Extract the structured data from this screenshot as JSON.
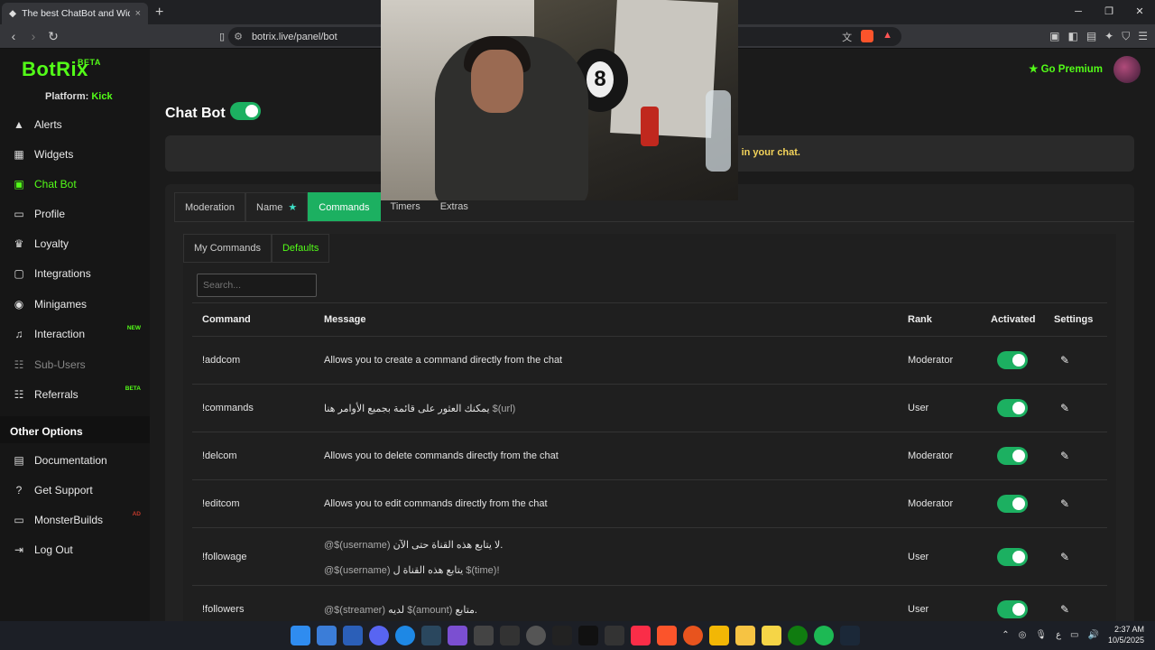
{
  "browser": {
    "tab_title": "The best ChatBot and Widgets fo",
    "url": "botrix.live/panel/bot",
    "new_tab": "+",
    "close_tab": "×"
  },
  "sidebar": {
    "brand": "BotRix",
    "brand_badge": "BETA",
    "platform_label": "Platform:",
    "platform_value": "Kick",
    "items": [
      {
        "label": "Alerts",
        "icon": "warning-icon"
      },
      {
        "label": "Widgets",
        "icon": "grid-icon"
      },
      {
        "label": "Chat Bot",
        "icon": "robot-icon"
      },
      {
        "label": "Profile",
        "icon": "id-card-icon"
      },
      {
        "label": "Loyalty",
        "icon": "trophy-icon"
      },
      {
        "label": "Integrations",
        "icon": "box-icon"
      },
      {
        "label": "Minigames",
        "icon": "gamepad-icon"
      },
      {
        "label": "Interaction",
        "icon": "music-icon",
        "tag": "NEW"
      },
      {
        "label": "Sub-Users",
        "icon": "users-icon"
      },
      {
        "label": "Referrals",
        "icon": "users-icon",
        "tag": "BETA"
      }
    ],
    "other_title": "Other Options",
    "other_items": [
      {
        "label": "Documentation",
        "icon": "book-icon"
      },
      {
        "label": "Get Support",
        "icon": "question-icon"
      },
      {
        "label": "MonsterBuilds",
        "icon": "monitor-icon",
        "tag": "AD"
      },
      {
        "label": "Log Out",
        "icon": "logout-icon"
      }
    ],
    "colors": {
      "accent": "#53fc18",
      "active_toggle": "#1cb061"
    }
  },
  "header": {
    "title": "Chat Bot",
    "premium": "Go Premium"
  },
  "banner": {
    "text": "in your chat."
  },
  "tabs": [
    "Moderation",
    "Name",
    "Commands",
    "Timers",
    "Extras"
  ],
  "subtabs": [
    "My Commands",
    "Defaults"
  ],
  "search": {
    "placeholder": "Search..."
  },
  "table": {
    "headers": [
      "Command",
      "Message",
      "Rank",
      "Activated",
      "Settings"
    ],
    "rows": [
      {
        "command": "!addcom",
        "message": "Allows you to create a command directly from the chat",
        "rank": "Moderator"
      },
      {
        "command": "!commands",
        "message": "يمكنك العثور على قائمة بجميع الأوامر هنا",
        "message_var": "$(url)",
        "rank": "User"
      },
      {
        "command": "!delcom",
        "message": "Allows you to delete commands directly from the chat",
        "rank": "Moderator"
      },
      {
        "command": "!editcom",
        "message": "Allows you to edit commands directly from the chat",
        "rank": "Moderator"
      },
      {
        "command": "!followage",
        "message_line1_var": "@$(username)",
        "message_line1": "لا يتابع هذه القناة حتى الآن.",
        "message_line2_var": "@$(username)",
        "message_line2": "يتابع هذه القناة ل",
        "message_line2_var2": "$(time)!",
        "rank": "User"
      },
      {
        "command": "!followers",
        "message_var": "@$(streamer)",
        "message_mid": "لديه",
        "message_var2": "$(amount)",
        "message": "متابع.",
        "rank": "User"
      }
    ]
  },
  "taskbar": {
    "time": "2:37 AM",
    "date": "10/5/2025",
    "lang": "ع"
  }
}
